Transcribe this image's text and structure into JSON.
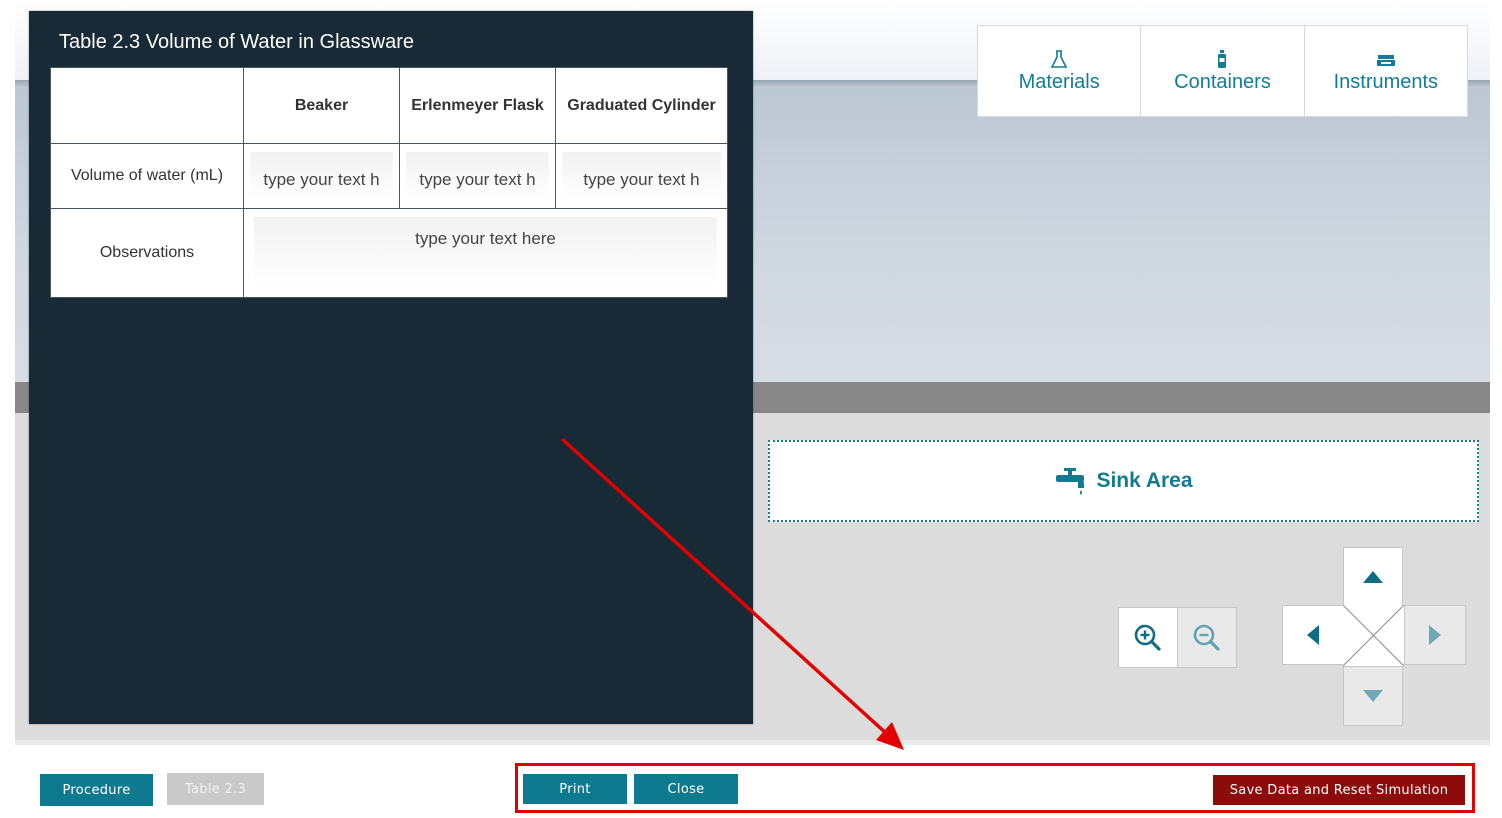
{
  "table_panel": {
    "title": "Table 2.3 Volume of Water in Glassware",
    "columns": [
      "Beaker",
      "Erlenmeyer Flask",
      "Graduated Cylinder"
    ],
    "rows": [
      {
        "label": "Volume of water (mL)",
        "cells": [
          "type your text h",
          "type your text h",
          "type your text h"
        ]
      },
      {
        "label": "Observations",
        "cells": [
          "type your text here"
        ]
      }
    ]
  },
  "top_tabs": {
    "materials": {
      "label": "Materials",
      "icon": "flask-icon"
    },
    "containers": {
      "label": "Containers",
      "icon": "bottle-icon"
    },
    "instruments": {
      "label": "Instruments",
      "icon": "scale-icon"
    }
  },
  "sink": {
    "label": "Sink Area",
    "icon": "faucet-icon"
  },
  "zoom": {
    "in_icon": "zoom-in-icon",
    "out_icon": "zoom-out-icon"
  },
  "footer": {
    "procedure": "Procedure",
    "table_tab": "Table 2.3",
    "print": "Print",
    "close": "Close",
    "save_reset": "Save Data and Reset Simulation"
  },
  "colors": {
    "accent": "#0e7a90",
    "danger": "#8e0b0b",
    "panel": "#172a36",
    "highlight": "#e30000"
  }
}
